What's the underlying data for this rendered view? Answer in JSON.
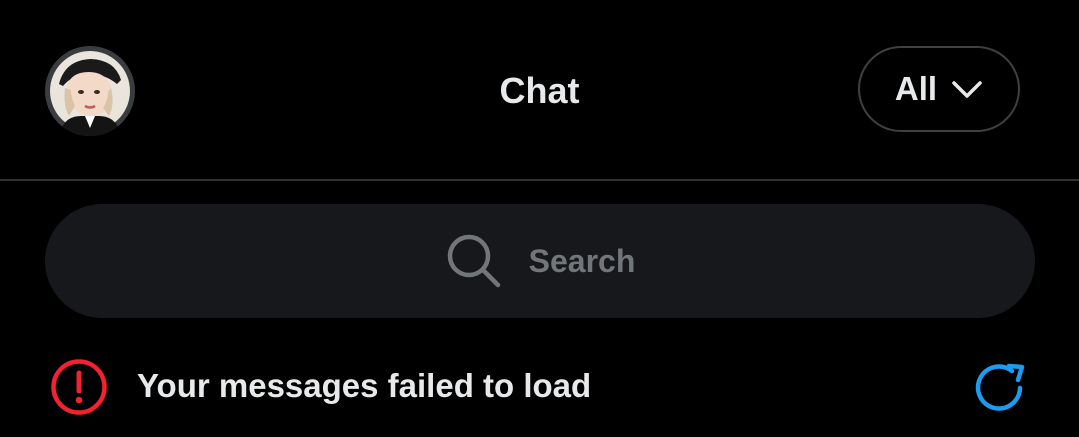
{
  "header": {
    "title": "Chat",
    "filter_label": "All"
  },
  "search": {
    "placeholder": "Search"
  },
  "error": {
    "message": "Your messages failed to load"
  },
  "icons": {
    "avatar": "profile-avatar",
    "filter_chevron": "chevron-down-icon",
    "search": "search-icon",
    "error": "alert-circle-icon",
    "refresh": "refresh-icon"
  },
  "colors": {
    "background": "#000000",
    "text_primary": "#e7e9ea",
    "text_secondary": "#71767b",
    "search_bg": "#16181c",
    "divider": "#2f3336",
    "error_red": "#f4212e",
    "refresh_blue": "#1d9bf0"
  }
}
